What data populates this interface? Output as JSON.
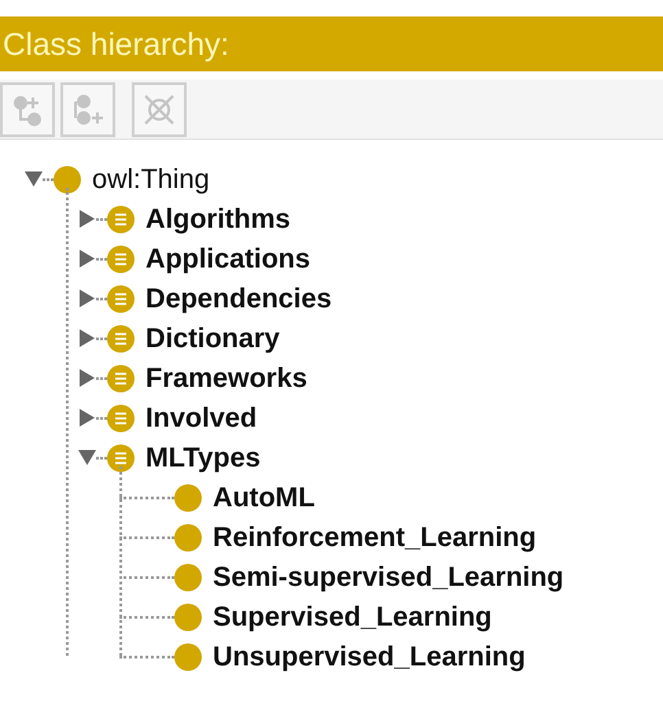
{
  "panel": {
    "title": "Class hierarchy:"
  },
  "toolbar": [
    {
      "kind": "add-subclass",
      "disabled": true
    },
    {
      "kind": "add-sibling",
      "disabled": true
    },
    {
      "kind": "delete",
      "disabled": true
    }
  ],
  "tree": [
    {
      "label": "owl:Thing",
      "kind": "root",
      "expanded": true,
      "children": [
        {
          "label": "Algorithms",
          "kind": "defined",
          "expanded": false
        },
        {
          "label": "Applications",
          "kind": "defined",
          "expanded": false
        },
        {
          "label": "Dependencies",
          "kind": "defined",
          "expanded": false
        },
        {
          "label": "Dictionary",
          "kind": "defined",
          "expanded": false
        },
        {
          "label": "Frameworks",
          "kind": "defined",
          "expanded": false
        },
        {
          "label": "Involved",
          "kind": "defined",
          "expanded": false
        },
        {
          "label": "MLTypes",
          "kind": "defined",
          "expanded": true,
          "children": [
            {
              "label": "AutoML",
              "kind": "primitive"
            },
            {
              "label": "Reinforcement_Learning",
              "kind": "primitive"
            },
            {
              "label": "Semi-supervised_Learning",
              "kind": "primitive"
            },
            {
              "label": "Supervised_Learning",
              "kind": "primitive"
            },
            {
              "label": "Unsupervised_Learning",
              "kind": "primitive"
            }
          ]
        }
      ]
    }
  ]
}
